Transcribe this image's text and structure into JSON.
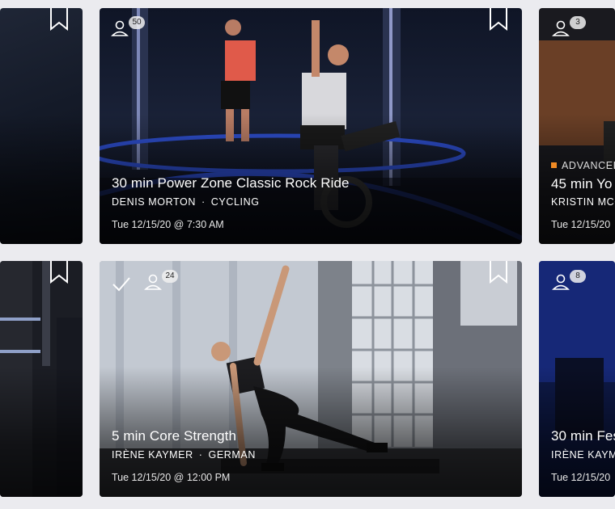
{
  "cards": [
    {
      "id": "left-top",
      "title": "",
      "users": ""
    },
    {
      "id": "center-top",
      "title": "30 min Power Zone Classic Rock Ride",
      "instructor": "DENIS MORTON",
      "discipline": "CYCLING",
      "separator": "·",
      "time": "Tue 12/15/20 @ 7:30 AM",
      "users": "50"
    },
    {
      "id": "right-top",
      "level": "ADVANCED",
      "title": "45 min Yo",
      "instructor": "KRISTIN MCC",
      "time": "Tue 12/15/20",
      "users": "3",
      "level_color": "#f08a24"
    },
    {
      "id": "left-bottom",
      "title": ""
    },
    {
      "id": "center-bottom",
      "title": "5 min Core Strength",
      "instructor": "IRÈNE KAYMER",
      "discipline": "GERMAN",
      "separator": "·",
      "time": "Tue 12/15/20 @ 12:00 PM",
      "users": "24"
    },
    {
      "id": "right-bottom",
      "title": "30 min Fes",
      "instructor": "IRÈNE KAYM",
      "time": "Tue 12/15/20",
      "users": "8"
    }
  ],
  "icons": {
    "users": "user-icon",
    "bookmark": "bookmark-icon",
    "completed": "checkmark-icon"
  },
  "colors": {
    "page_bg": "#ebebef",
    "badge_bg": "#f0f0f0",
    "advanced": "#f08a24"
  }
}
